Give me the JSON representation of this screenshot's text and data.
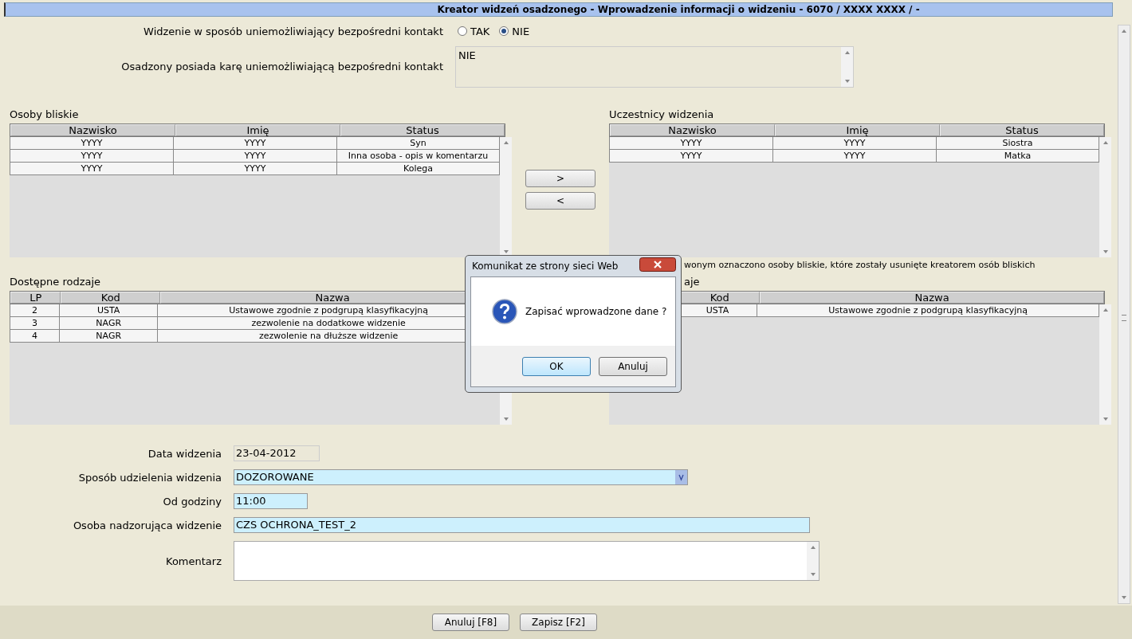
{
  "window": {
    "title": "Kreator widzeń osadzonego - Wprowadzenie informacji o widzeniu - 6070 / XXXX XXXX / -"
  },
  "direct_contact": {
    "label": "Widzenie w sposób uniemożliwiający bezpośredni kontakt",
    "options": [
      {
        "label": "TAK",
        "selected": false
      },
      {
        "label": "NIE",
        "selected": true
      }
    ]
  },
  "penalty": {
    "label": "Osadzony posiada karę uniemożliwiającą bezpośredni kontakt",
    "value": "NIE"
  },
  "close_persons": {
    "title": "Osoby bliskie",
    "columns": [
      "Nazwisko",
      "Imię",
      "Status"
    ],
    "rows": [
      [
        "YYYY",
        "YYYY",
        "Syn"
      ],
      [
        "YYYY",
        "YYYY",
        "Inna osoba - opis w komentarzu"
      ],
      [
        "YYYY",
        "YYYY",
        "Kolega"
      ]
    ]
  },
  "move_buttons": [
    ">",
    "<"
  ],
  "participants": {
    "title": "Uczestnicy widzenia",
    "columns": [
      "Nazwisko",
      "Imię",
      "Status"
    ],
    "rows": [
      [
        "YYYY",
        "YYYY",
        "Siostra"
      ],
      [
        "YYYY",
        "YYYY",
        "Matka"
      ]
    ]
  },
  "note": "wonym oznaczono osoby bliskie, które zostały usunięte kreatorem osób bliskich",
  "available_types": {
    "title": "Dostępne rodzaje",
    "columns": [
      "LP",
      "Kod",
      "Nazwa"
    ],
    "rows": [
      [
        "2",
        "USTA",
        "Ustawowe zgodnie z podgrupą klasyfikacyjną"
      ],
      [
        "3",
        "NAGR",
        "zezwolenie na dodatkowe widzenie"
      ],
      [
        "4",
        "NAGR",
        "zezwolenie na dłuższe widzenie"
      ]
    ]
  },
  "selected_types": {
    "title": "aje",
    "columns": [
      "Kod",
      "Nazwa"
    ],
    "rows": [
      [
        "USTA",
        "Ustawowe zgodnie z podgrupą klasyfikacyjną"
      ]
    ]
  },
  "form": [
    {
      "kind": "display",
      "label": "Data widzenia",
      "value": "23-04-2012"
    },
    {
      "kind": "select",
      "label": "Sposób udzielenia widzenia",
      "value": "DOZOROWANE"
    },
    {
      "kind": "time",
      "label": "Od godziny",
      "value": "11:00"
    },
    {
      "kind": "text",
      "label": "Osoba nadzorująca widzenie",
      "value": "CZS OCHRONA_TEST_2"
    },
    {
      "kind": "textarea",
      "label": "Komentarz"
    }
  ],
  "footer_buttons": [
    "Anuluj [F8]",
    "Zapisz [F2]"
  ],
  "dialog": {
    "title": "Komunikat ze strony sieci Web",
    "message": "Zapisać wprowadzone dane ?",
    "buttons": [
      {
        "label": "OK",
        "default": true
      },
      {
        "label": "Anuluj",
        "default": false
      }
    ]
  }
}
